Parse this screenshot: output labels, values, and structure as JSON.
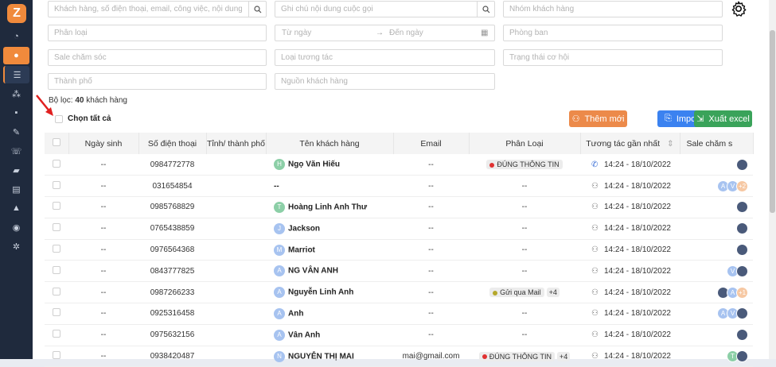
{
  "search": {
    "customer_placeholder": "Khách hàng, số điện thoại, email, công việc, nội dung gi...",
    "note_placeholder": "Ghi chú nội dung cuộc gọi",
    "group_placeholder": "Nhóm khách hàng",
    "category_placeholder": "Phân loại",
    "from_date": "Từ ngày",
    "to_date": "Đến ngày",
    "department_placeholder": "Phòng ban",
    "sale_placeholder": "Sale chăm sóc",
    "interaction_type_placeholder": "Loại tương tác",
    "opportunity_placeholder": "Trạng thái cơ hội",
    "city_placeholder": "Thành phố",
    "source_placeholder": "Nguồn khách hàng"
  },
  "filter": {
    "label": "Bộ lọc:",
    "count": "40",
    "suffix": "khách hàng"
  },
  "select_all_label": "Chọn tất cả",
  "buttons": {
    "add": "Thêm mới",
    "import": "Import",
    "excel": "Xuất excel"
  },
  "table": {
    "headers": [
      "Ngày sinh",
      "Số điện thoại",
      "Tỉnh/ thành phố",
      "Tên khách hàng",
      "Email",
      "Phân Loại",
      "Tương tác gần nhất",
      "Sale chăm s"
    ],
    "rows": [
      {
        "birth": "--",
        "phone": "0984772778",
        "city": "",
        "initial": "H",
        "name": "Ngọ Văn Hiếu",
        "email": "--",
        "tag": "ĐÚNG THÔNG TIN",
        "tag_color": "#e03131",
        "more": "",
        "interaction_icon": "phone",
        "time": "14:24 - 18/10/2022",
        "sale": [
          "photo"
        ]
      },
      {
        "birth": "--",
        "phone": "031654854",
        "city": "",
        "initial": "",
        "name": "--",
        "email": "--",
        "tag": "--",
        "tag_color": "",
        "more": "",
        "interaction_icon": "person",
        "time": "14:24 - 18/10/2022",
        "sale": [
          "A",
          "V",
          "+2"
        ]
      },
      {
        "birth": "--",
        "phone": "0985768829",
        "city": "",
        "initial": "T",
        "name": "Hoàng Linh Anh Thư",
        "email": "--",
        "tag": "--",
        "tag_color": "",
        "more": "",
        "interaction_icon": "person",
        "time": "14:24 - 18/10/2022",
        "sale": [
          "photo"
        ]
      },
      {
        "birth": "--",
        "phone": "0765438859",
        "city": "",
        "initial": "J",
        "name": "Jackson",
        "email": "--",
        "tag": "--",
        "tag_color": "",
        "more": "",
        "interaction_icon": "person",
        "time": "14:24 - 18/10/2022",
        "sale": [
          "photo"
        ]
      },
      {
        "birth": "--",
        "phone": "0976564368",
        "city": "",
        "initial": "M",
        "name": "Marriot",
        "email": "--",
        "tag": "--",
        "tag_color": "",
        "more": "",
        "interaction_icon": "person",
        "time": "14:24 - 18/10/2022",
        "sale": [
          "photo"
        ]
      },
      {
        "birth": "--",
        "phone": "0843777825",
        "city": "",
        "initial": "A",
        "name": "NG VÂN ANH",
        "email": "--",
        "tag": "--",
        "tag_color": "",
        "more": "",
        "interaction_icon": "person",
        "time": "14:24 - 18/10/2022",
        "sale": [
          "V",
          "photo"
        ]
      },
      {
        "birth": "--",
        "phone": "0987266233",
        "city": "",
        "initial": "A",
        "name": "Nguyễn Linh Anh",
        "email": "--",
        "tag": "Gửi qua Mail",
        "tag_color": "#b5a82c",
        "more": "+4",
        "interaction_icon": "person",
        "time": "14:24 - 18/10/2022",
        "sale": [
          "photo",
          "A",
          "+1"
        ]
      },
      {
        "birth": "--",
        "phone": "0925316458",
        "city": "",
        "initial": "A",
        "name": "Anh",
        "email": "--",
        "tag": "--",
        "tag_color": "",
        "more": "",
        "interaction_icon": "person",
        "time": "14:24 - 18/10/2022",
        "sale": [
          "A",
          "V",
          "photo"
        ]
      },
      {
        "birth": "--",
        "phone": "0975632156",
        "city": "",
        "initial": "A",
        "name": "Vân Anh",
        "email": "--",
        "tag": "--",
        "tag_color": "",
        "more": "",
        "interaction_icon": "person",
        "time": "14:24 - 18/10/2022",
        "sale": [
          "photo"
        ]
      },
      {
        "birth": "--",
        "phone": "0938420487",
        "city": "",
        "initial": "N",
        "name": "NGUYỄN THỊ MAI",
        "email": "mai@gmail.com",
        "tag": "ĐÚNG THÔNG TIN",
        "tag_color": "#e03131",
        "more": "+4",
        "interaction_icon": "person",
        "time": "14:24 - 18/10/2022",
        "sale": [
          "T",
          "photo"
        ]
      }
    ]
  },
  "colors": {
    "sidebar": "#1f2a3d",
    "accent": "#f08a3c",
    "import": "#3b82f0",
    "excel": "#3aa35a"
  },
  "nav_icons": [
    "logo-icon",
    "dashboard-icon",
    "customer-icon",
    "list-icon",
    "group-icon",
    "briefcase-icon",
    "edit-icon",
    "phone-icon",
    "ticket-icon",
    "chart-icon",
    "product-icon",
    "user-icon",
    "settings-icon"
  ]
}
